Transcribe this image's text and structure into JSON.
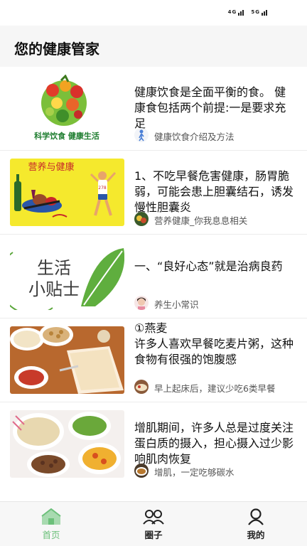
{
  "status": {
    "sig1": "4G",
    "sig2": "5G"
  },
  "header": {
    "title": "您的健康管家"
  },
  "feed": [
    {
      "text": "健康饮食是全面平衡的食。 健康食包括两个前提:一是要求充足",
      "source": "健康饮食介绍及方法",
      "thumb_text": "科学饮食 健康生活"
    },
    {
      "text": "1、不吃早餐危害健康，肠胃脆弱，可能会患上胆囊结石，诱发慢性胆囊炎",
      "source": "营养健康_你我息息相关",
      "thumb_text": "营养与健康"
    },
    {
      "text": "一、“良好心态”就是治病良药",
      "source": "养生小常识",
      "thumb_text1": "生活",
      "thumb_text2": "小贴士"
    },
    {
      "text": "①燕麦\n许多人喜欢早餐吃麦片粥，这种食物有很强的饱腹感",
      "source": "早上起床后，建议少吃6类早餐"
    },
    {
      "text": "增肌期间，许多人总是过度关注蛋白质的摄入，担心摄入过少影响肌肉恢复",
      "source": "增肌，一定吃够碳水"
    }
  ],
  "tabs": [
    {
      "label": "首页",
      "icon": "home-icon"
    },
    {
      "label": "圈子",
      "icon": "people-icon"
    },
    {
      "label": "我的",
      "icon": "person-icon"
    }
  ],
  "colors": {
    "accent": "#6cc07a",
    "header_bg": "#f6f6f6"
  }
}
